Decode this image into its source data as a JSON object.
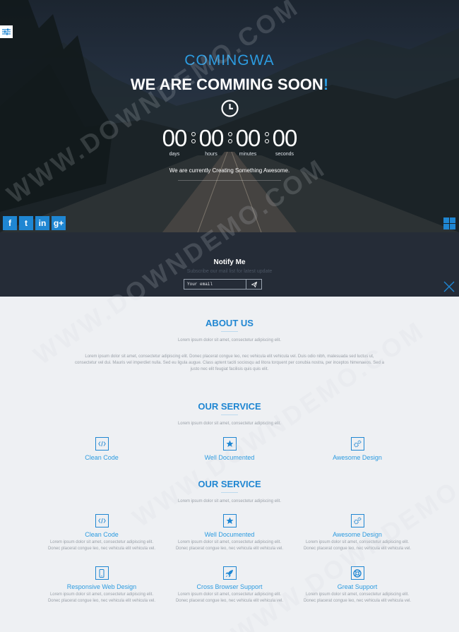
{
  "hero": {
    "brand": "COMINGWA",
    "headline": "WE ARE COMMING SOON",
    "headline_bang": "!",
    "countdown": [
      {
        "value": "00",
        "label": "days"
      },
      {
        "value": "00",
        "label": "hours"
      },
      {
        "value": "00",
        "label": "minutes"
      },
      {
        "value": "00",
        "label": "seconds"
      }
    ],
    "tagline": "We are currently Creating Something Awesome.",
    "social": [
      {
        "icon": "facebook-icon",
        "glyph": "f"
      },
      {
        "icon": "twitter-icon",
        "glyph": "t"
      },
      {
        "icon": "linkedin-icon",
        "glyph": "in"
      },
      {
        "icon": "google-plus-icon",
        "glyph": "g+"
      }
    ]
  },
  "notify": {
    "title": "Notify Me",
    "subtitle": "Subscribe our mail list for latest update",
    "email_placeholder": "Your email"
  },
  "about": {
    "title": "ABOUT US",
    "subtitle": "Lorem ipsum dolor sit amet, consectetur adipiscing elit.",
    "body": "Lorem ipsum dolor sit amet, consectetur adipiscing elit. Donec placerat congue leo, nec vehicula elit vehicula vel. Duis odio nibh, malesuada sed luctus ut, consectetur vel dui. Mauris vel imperdiet nulla. Sed eu ligula augue. Class aptent taciti sociosqu ad litora torquent per conubia nostra, per inceptos himenaeos. Sed a justo nec elit feugiat facilisis quis quis elit."
  },
  "service1": {
    "title": "OUR SERVICE",
    "subtitle": "Lorem ipsum dolor sit amet, consectetur adipiscing elit.",
    "items": [
      {
        "icon": "code-icon",
        "name": "Clean Code"
      },
      {
        "icon": "star-icon",
        "name": "Well Documented"
      },
      {
        "icon": "cogs-icon",
        "name": "Awesome Design"
      }
    ]
  },
  "service2": {
    "title": "OUR SERVICE",
    "subtitle": "Lorem ipsum dolor sit amet, consectetur adipiscing elit.",
    "items": [
      {
        "icon": "code-icon",
        "name": "Clean Code",
        "desc1": "Lorem ipsum dolor sit amet, consectetur adipiscing elit.",
        "desc2": "Donec placerat congue leo, nec vehicula elit vehicula vel."
      },
      {
        "icon": "star-icon",
        "name": "Well Documented",
        "desc1": "Lorem ipsum dolor sit amet, consectetur adipiscing elit.",
        "desc2": "Donec placerat congue leo, nec vehicula elit vehicula vel."
      },
      {
        "icon": "cogs-icon",
        "name": "Awesome Design",
        "desc1": "Lorem ipsum dolor sit amet, consectetur adipiscing elit.",
        "desc2": "Donec placerat congue leo, nec vehicula elit vehicula vel."
      },
      {
        "icon": "mobile-icon",
        "name": "Responsive Web Design",
        "desc1": "Lorem ipsum dolor sit amet, consectetur adipiscing elit.",
        "desc2": "Donec placerat congue leo, nec vehicula elit vehicula vel."
      },
      {
        "icon": "rocket-icon",
        "name": "Cross Browser Support",
        "desc1": "Lorem ipsum dolor sit amet, consectetur adipiscing elit.",
        "desc2": "Donec placerat congue leo, nec vehicula elit vehicula vel."
      },
      {
        "icon": "life-ring-icon",
        "name": "Great Support",
        "desc1": "Lorem ipsum dolor sit amet, consectetur adipiscing elit.",
        "desc2": "Donec placerat congue leo, nec vehicula elit vehicula vel."
      }
    ]
  },
  "watermark": "WWW.DOWNDEMO.COM",
  "colors": {
    "accent": "#1f86d2",
    "brand": "#2c9be0",
    "hero_bg": "#243040",
    "notify_bg": "#252c37",
    "page_bg": "#eef0f3"
  }
}
